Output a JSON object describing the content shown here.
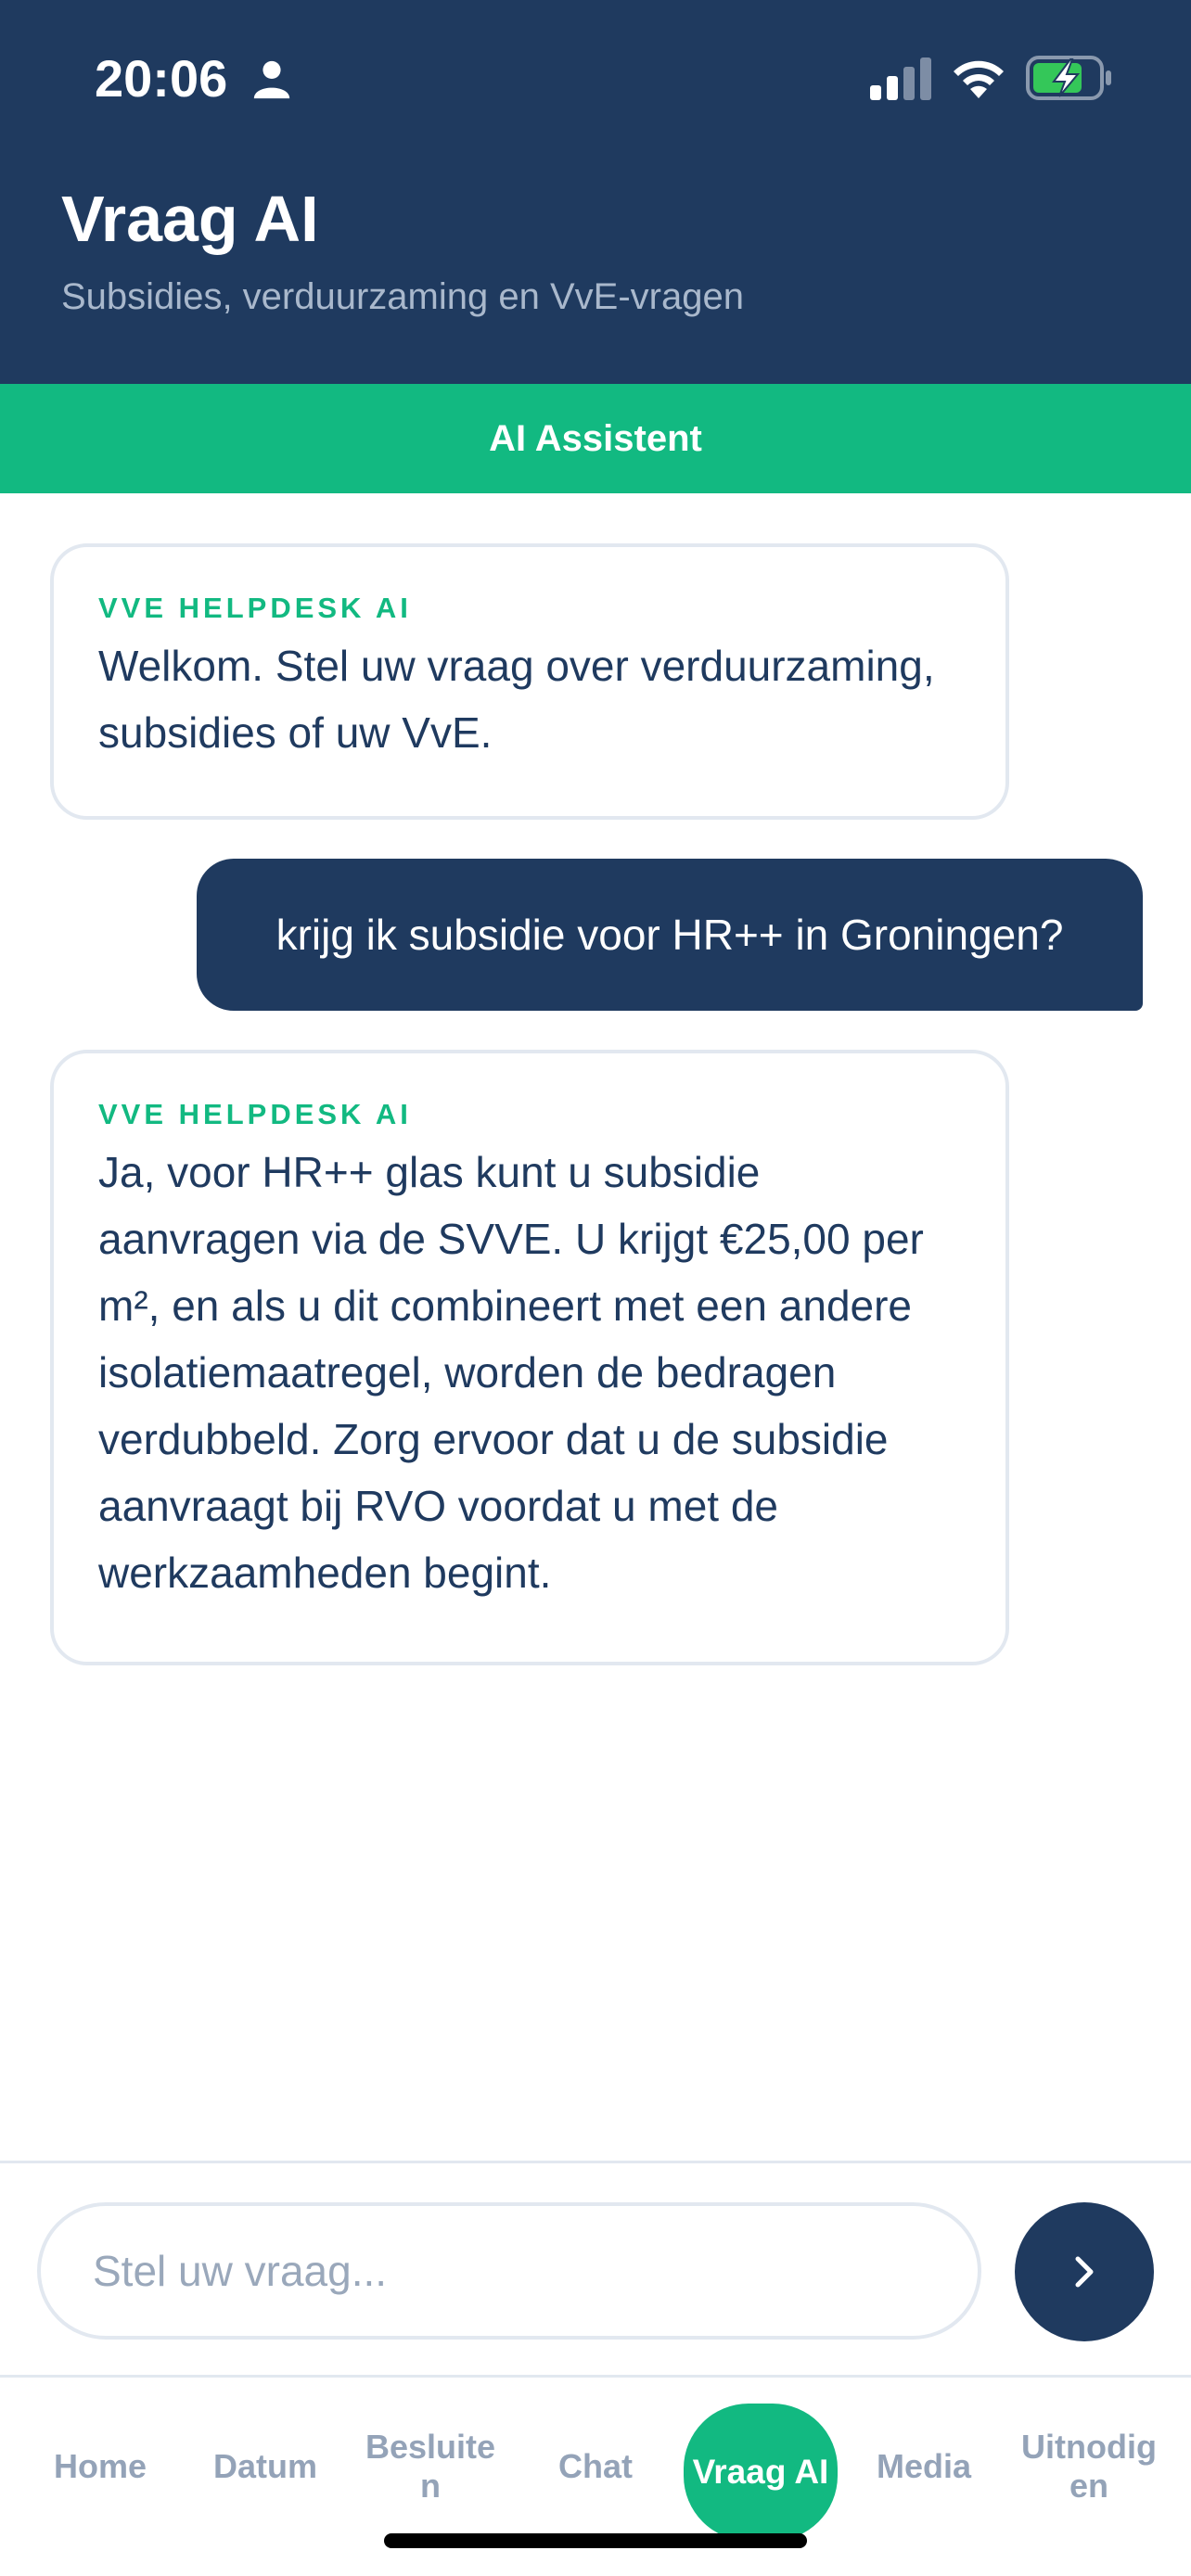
{
  "status_bar": {
    "time": "20:06",
    "icons": [
      "person-icon",
      "signal-icon",
      "wifi-icon",
      "battery-charging-icon"
    ]
  },
  "header": {
    "title": "Vraag AI",
    "subtitle": "Subsidies, verduurzaming en VvE-vragen"
  },
  "banner": {
    "label": "AI Assistent"
  },
  "chat": {
    "messages": [
      {
        "role": "assistant",
        "sender": "VVE HELPDESK AI",
        "text": "Welkom. Stel uw vraag over verduurzaming, subsidies of uw VvE."
      },
      {
        "role": "user",
        "text": "krijg ik subsidie voor HR++ in Groningen?"
      },
      {
        "role": "assistant",
        "sender": "VVE HELPDESK AI",
        "text": "Ja, voor HR++ glas kunt u subsidie aanvragen via de SVVE. U krijgt €25,00 per m², en als u dit combineert met een andere isolatiemaatregel, worden de bedragen verdubbeld. Zorg ervoor dat u de subsidie aanvraagt bij RVO voordat u met de werkzaamheden begint."
      }
    ]
  },
  "input": {
    "placeholder": "Stel uw vraag...",
    "value": "",
    "send_icon": "chevron-right-icon"
  },
  "nav": {
    "items": [
      {
        "label": "Home",
        "active": false
      },
      {
        "label": "Datum",
        "active": false
      },
      {
        "label": "Besluiten",
        "display": "Besluite\nn",
        "active": false
      },
      {
        "label": "Chat",
        "active": false
      },
      {
        "label": "Vraag AI",
        "active": true
      },
      {
        "label": "Media",
        "active": false
      },
      {
        "label": "Uitnodigen",
        "display": "Uitnodig\nen",
        "active": false
      }
    ]
  },
  "colors": {
    "primary": "#1f3a5f",
    "accent": "#12b981",
    "border": "#e2e8f0",
    "muted": "#94a3b8"
  }
}
